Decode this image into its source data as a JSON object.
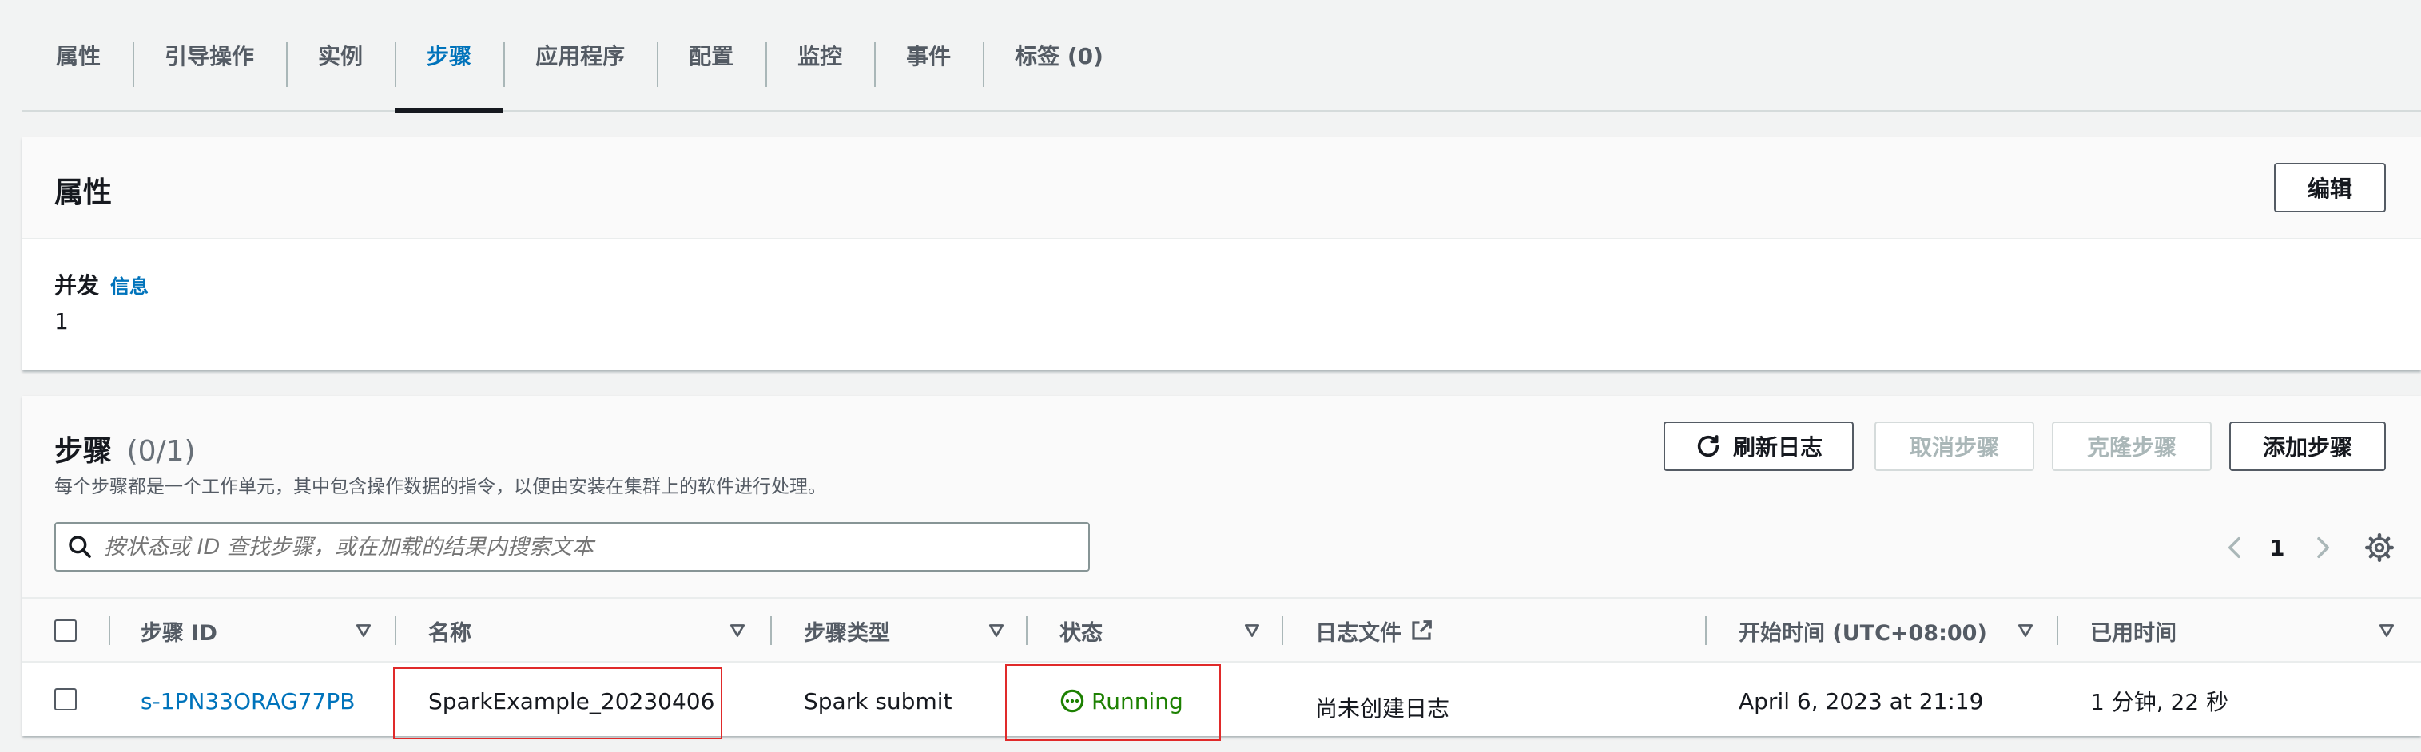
{
  "tabs": [
    "属性",
    "引导操作",
    "实例",
    "步骤",
    "应用程序",
    "配置",
    "监控",
    "事件",
    "标签 (0)"
  ],
  "properties": {
    "title": "属性",
    "edit_label": "编辑",
    "concurrency_label": "并发",
    "info_link": "信息",
    "concurrency_value": "1"
  },
  "steps": {
    "title": "步骤",
    "count": "(0/1)",
    "description": "每个步骤都是一个工作单元，其中包含操作数据的指令，以便由安装在集群上的软件进行处理。",
    "refresh_label": "刷新日志",
    "cancel_label": "取消步骤",
    "clone_label": "克隆步骤",
    "add_label": "添加步骤",
    "search_placeholder": "按状态或 ID 查找步骤，或在加载的结果内搜索文本",
    "page_number": "1",
    "columns": {
      "id": "步骤 ID",
      "name": "名称",
      "type": "步骤类型",
      "status": "状态",
      "logs": "日志文件",
      "start": "开始时间 (UTC+08:00)",
      "elapsed": "已用时间"
    },
    "rows": [
      {
        "id": "s-1PN33ORAG77PB",
        "name": "SparkExample_20230406",
        "type": "Spark submit",
        "status": "Running",
        "logs": "尚未创建日志",
        "start": "April 6, 2023 at 21:19",
        "elapsed": "1 分钟, 22 秒"
      }
    ]
  },
  "colors": {
    "link": "#0073bb",
    "status_running": "#1d8102",
    "highlight": "#e02a2a"
  }
}
